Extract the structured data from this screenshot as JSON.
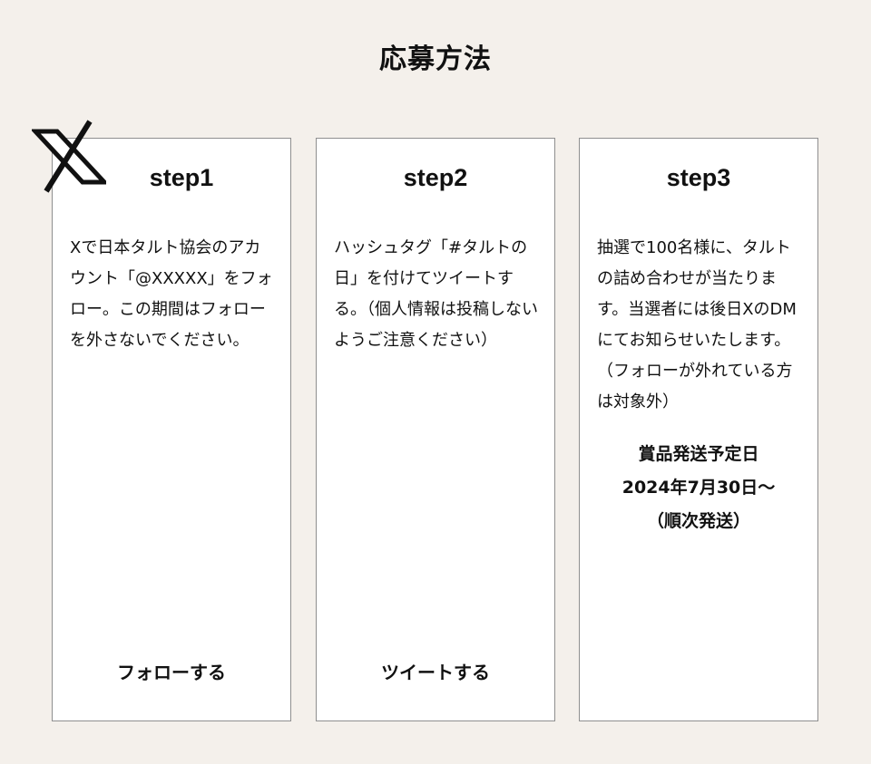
{
  "page": {
    "title": "応募方法"
  },
  "steps": [
    {
      "heading": "step1",
      "text": "Xで日本タルト協会のアカウント「@XXXXX」をフォロー。この期間はフォローを外さないでください。",
      "button_label": "フォローする"
    },
    {
      "heading": "step2",
      "text": "ハッシュタグ「#タルトの日」を付けてツイートする。（個人情報は投稿しないようご注意ください）",
      "button_label": "ツイートする"
    },
    {
      "heading": "step3",
      "text": "抽選で100名様に、タルトの詰め合わせが当たります。当選者には後日XのDMにてお知らせいたします。（フォローが外れている方は対象外）",
      "schedule": {
        "label": "賞品発送予定日",
        "date": "2024年7月30日〜",
        "note": "（順次発送）"
      }
    }
  ],
  "icons": {
    "x_logo": "x-logo-icon"
  },
  "colors": {
    "background": "#f4f0eb",
    "card": "#ffffff",
    "border": "#8f8f8f",
    "text": "#111111"
  }
}
